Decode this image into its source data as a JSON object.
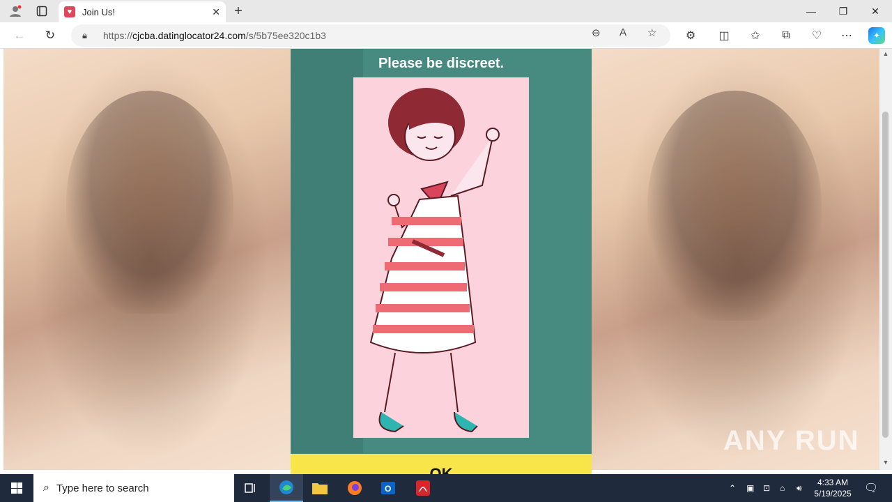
{
  "browser": {
    "tab": {
      "title": "Join Us!"
    },
    "address": {
      "url_prefix": "https://",
      "host": "cjcba.datinglocator24.com",
      "path": "/s/5b75ee320c1b3"
    }
  },
  "page": {
    "heading": "Please be discreet.",
    "button_label": "OK"
  },
  "watermark": "ANY RUN",
  "taskbar": {
    "search_placeholder": "Type here to search",
    "time": "4:33 AM",
    "date": "5/19/2025"
  },
  "colors": {
    "panel": "#468a80",
    "art_background": "#fcd3dd",
    "button": "#f7e54a"
  }
}
